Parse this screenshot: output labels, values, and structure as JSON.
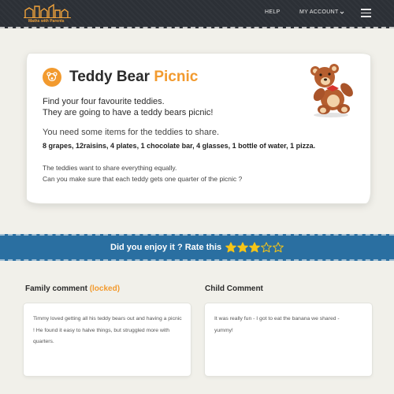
{
  "header": {
    "logo_text": "Maths with Parents",
    "nav": {
      "help": "HELP",
      "account": "MY ACCOUNT"
    },
    "bg_color": "#2c3036"
  },
  "activity": {
    "title_main": "Teddy Bear",
    "title_accent": "Picnic",
    "intro_line1": "Find your four favourite teddies.",
    "intro_line2": "They are going to have a teddy bears picnic!",
    "needs": "You need some items for the teddies to share.",
    "items": "8 grapes,  12raisins,  4 plates,  1 chocolate bar,  4 glasses,  1 bottle of water,  1 pizza.",
    "share_line1": "The teddies want to share everything equally.",
    "share_line2": "Can you make sure that each teddy gets one quarter of the picnic ?",
    "icon": "teddy-bear-icon",
    "accent_color": "#f29a2e"
  },
  "rating": {
    "prompt": "Did you enjoy it ? Rate this",
    "stars_filled": 3,
    "stars_total": 5,
    "bar_color": "#2a6fa1",
    "star_color": "#f5c518"
  },
  "comments": {
    "family": {
      "heading": "Family comment",
      "status": "(locked)",
      "text": "Timmy loved getting all his teddy bears out and having a picnic ! He found it easy to halve things, but struggled more with quarters."
    },
    "child": {
      "heading": "Child Comment",
      "text": "It was really fun - I got to eat the banana we shared - yummy!"
    }
  }
}
